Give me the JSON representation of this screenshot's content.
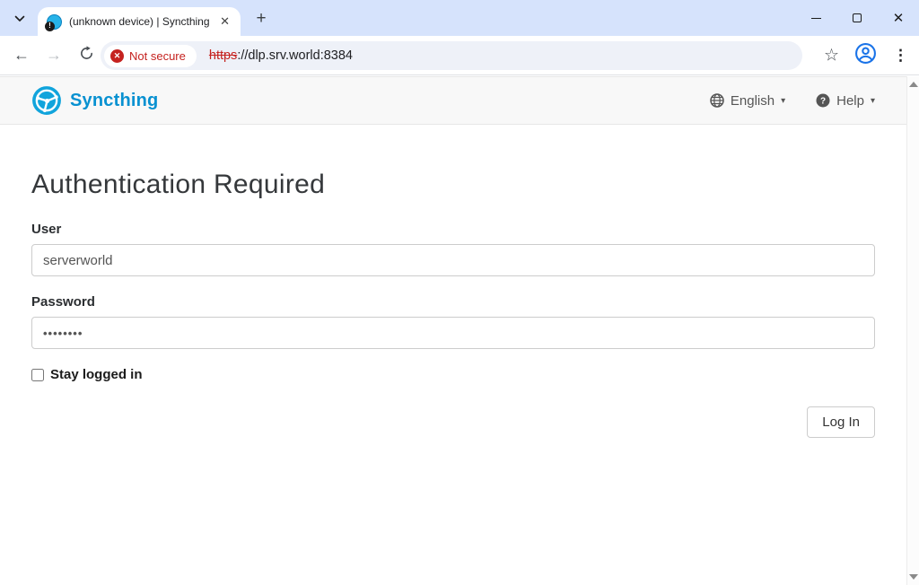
{
  "browser": {
    "tab": {
      "title": "(unknown device) | Syncthing",
      "favicon_badge": "!"
    },
    "icons": {
      "close": "✕",
      "plus": "+",
      "back_arrow": "←",
      "forward_arrow": "→",
      "star": "☆",
      "menu_dots": "⋮",
      "chip_x": "✕",
      "caret_down": "▾"
    },
    "address_bar": {
      "security_chip": "Not secure",
      "url_scheme": "https",
      "url_rest": "://dlp.srv.world:8384"
    }
  },
  "navbar": {
    "brand": "Syncthing",
    "language_label": "English",
    "help_label": "Help"
  },
  "main": {
    "heading": "Authentication Required",
    "user_label": "User",
    "user_value": "serverworld",
    "password_label": "Password",
    "password_value": "••••••••",
    "stay_logged_in_label": "Stay logged in",
    "login_button_label": "Log In"
  },
  "colors": {
    "brand_blue": "#0891d1",
    "not_secure_red": "#c5221f",
    "tab_strip_blue": "#d6e3fc",
    "navbar_gray": "#f8f8f8"
  }
}
